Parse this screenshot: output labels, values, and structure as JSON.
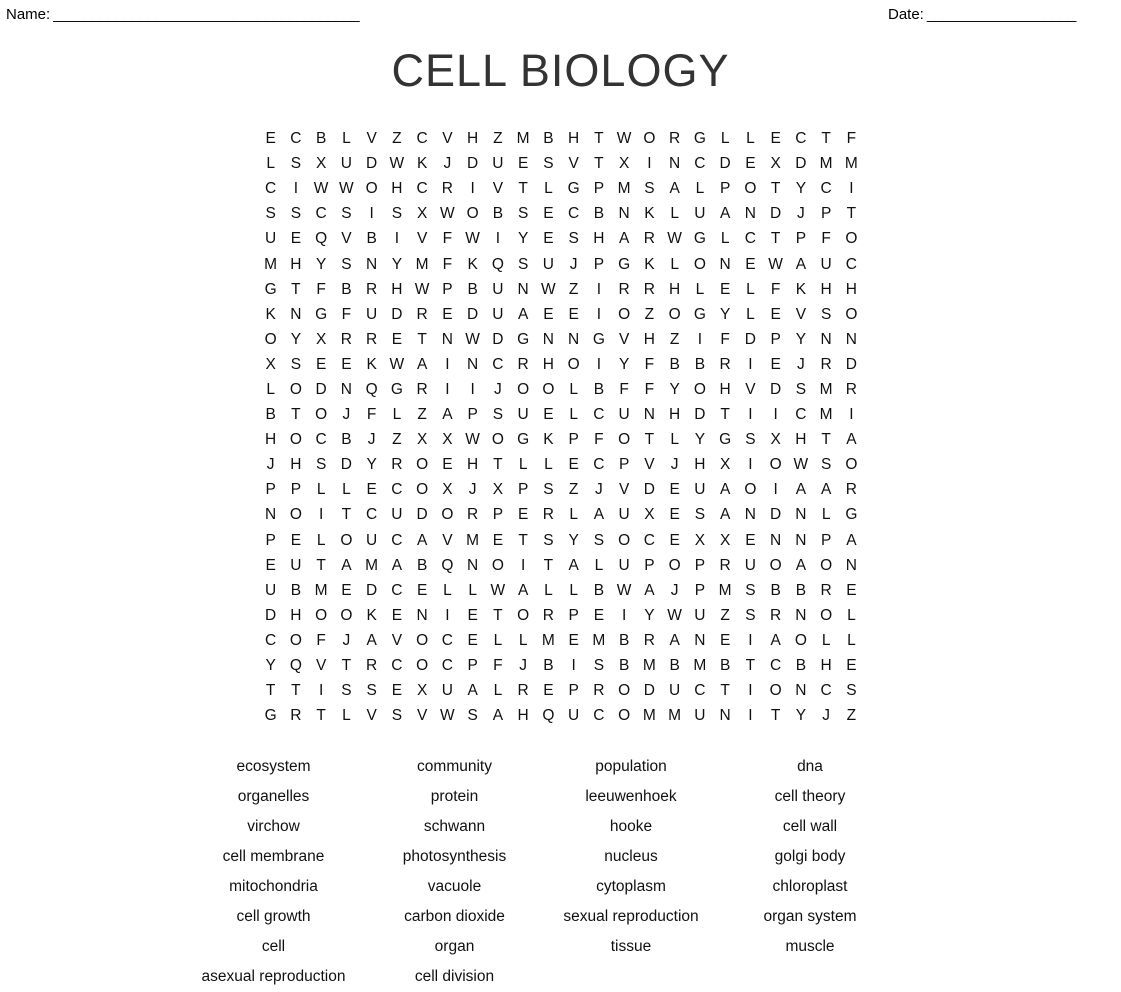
{
  "header": {
    "name_label": "Name:",
    "name_rule": "_______________________________________",
    "date_label": "Date:",
    "date_rule": "___________________"
  },
  "title": "CELL BIOLOGY",
  "puzzle": {
    "rows": 24,
    "cols": 24,
    "grid": [
      "E C B L V Z C V H Z M B H T W O R G L L E C T F",
      "L S X U D W K J D U E S V T X I N C D E X D M M",
      "C I W W O H C R I V T L G P M S A L P O T Y C I",
      "S S C S I S X W O B S E C B N K L U A N D J P T",
      "U E Q V B I V F W I Y E S H A R W G L C T P F O",
      "M H Y S N Y M F K Q S U J P G K L O N E W A U C",
      "G T F B R H W P B U N W Z I R R H L E L F K H H",
      "K N G F U D R E D U A E E I O Z O G Y L E V S O",
      "O Y X R R E T N W D G N N G V H Z I F D P Y N N",
      "X S E E K W A I N C R H O I Y F B B R I E J R D",
      "L O D N Q G R I I J O O L B F F Y O H V D S M R",
      "B T O J F L Z A P S U E L C U N H D T I I C M I",
      "H O C B J Z X X W O G K P F O T L Y G S X H T A",
      "J H S D Y R O E H T L L E C P V J H X I O W S O",
      "P P L L E C O X J X P S Z J V D E U A O I A A R",
      "N O I T C U D O R P E R L A U X E S A N D N L G",
      "P E L O U C A V M E T S Y S O C E X X E N N P A",
      "E U T A M A B Q N O I T A L U P O P R U O A O N",
      "U B M E D C E L L W A L L B W A J P M S B B R E",
      "D H O O K E N I E T O R P E I Y W U Z S R N O L",
      "C O F J A V O C E L L M E M B R A N E I A O L L",
      "Y Q V T R C O C P F J B I S B M B M B T C B H E",
      "T T I S S E X U A L R E P R O D U C T I O N C S",
      "G R T L V S V W S A H Q U C O M M U N I T Y J Z"
    ]
  },
  "wordlist": {
    "rows": [
      [
        "ecosystem",
        "community",
        "population",
        "dna"
      ],
      [
        "organelles",
        "protein",
        "leeuwenhoek",
        "cell theory"
      ],
      [
        "virchow",
        "schwann",
        "hooke",
        "cell wall"
      ],
      [
        "cell membrane",
        "photosynthesis",
        "nucleus",
        "golgi body"
      ],
      [
        "mitochondria",
        "vacuole",
        "cytoplasm",
        "chloroplast"
      ],
      [
        "cell growth",
        "carbon dioxide",
        "sexual reproduction",
        "organ system"
      ],
      [
        "cell",
        "organ",
        "tissue",
        "muscle"
      ],
      [
        "asexual reproduction",
        "cell division",
        "",
        ""
      ]
    ]
  }
}
